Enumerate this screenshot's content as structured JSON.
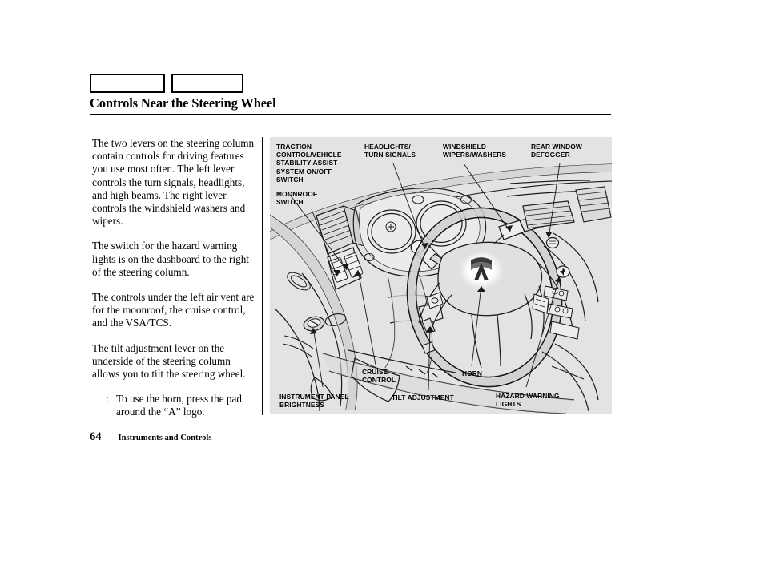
{
  "page": {
    "title": "Controls Near the Steering Wheel",
    "tabs": [
      {
        "label": ""
      },
      {
        "label": ""
      }
    ],
    "footer": {
      "page_number": "64",
      "section": "Instruments and Controls"
    }
  },
  "body": {
    "paragraphs": [
      "The two levers on the steering column contain controls for driving features you use most often. The left lever controls the turn signals, headlights, and high beams. The right lever controls the windshield washers and wipers.",
      "The switch for the hazard warning lights is on the dashboard to the right of the steering column.",
      "The controls under the left air vent are for the moonroof, the cruise control, and the VSA/TCS.",
      "The tilt adjustment lever on the underside of the steering column allows you to tilt the steering wheel."
    ],
    "notice": {
      "marker": ":",
      "text": "To use the horn, press the pad around the “A” logo."
    }
  },
  "figure": {
    "background_color": "#e3e3e3",
    "callouts": [
      {
        "id": "traction",
        "label": "TRACTION\nCONTROL/VEHICLE\nSTABILITY ASSIST\nSYSTEM ON/OFF\nSWITCH"
      },
      {
        "id": "moonroof",
        "label": "MOONROOF\nSWITCH"
      },
      {
        "id": "headlights",
        "label": "HEADLIGHTS/\nTURN SIGNALS"
      },
      {
        "id": "windshield",
        "label": "WINDSHIELD\nWIPERS/WASHERS"
      },
      {
        "id": "rearwindow",
        "label": "REAR WINDOW\nDEFOGGER"
      },
      {
        "id": "instrument",
        "label": "INSTRUMENT PANEL\nBRIGHTNESS"
      },
      {
        "id": "cruise",
        "label": "CRUISE\nCONTROL"
      },
      {
        "id": "tilt",
        "label": "TILT ADJUSTMENT"
      },
      {
        "id": "horn",
        "label": "HORN"
      },
      {
        "id": "hazard",
        "label": "HAZARD WARNING\nLIGHTS"
      }
    ],
    "illustration": {
      "name": "dashboard-steering-wheel-illustration",
      "logo_text": "A"
    }
  }
}
